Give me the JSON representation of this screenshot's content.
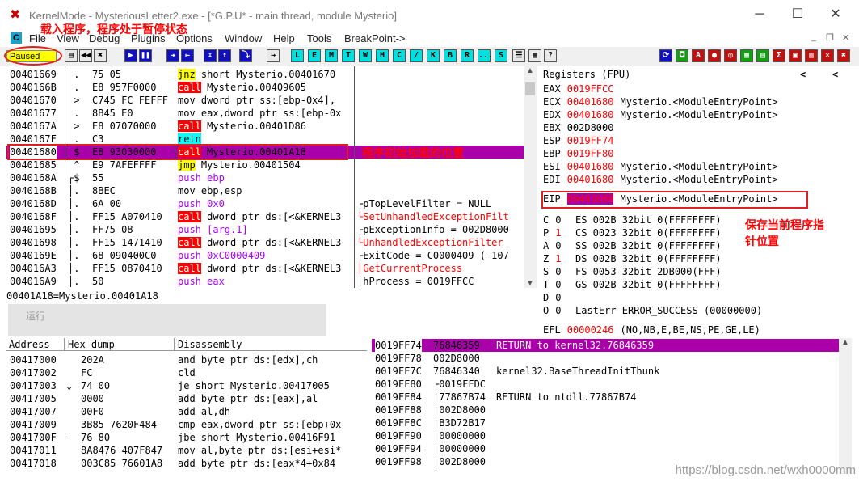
{
  "window": {
    "title": "KernelMode - MysteriousLetter2.exe - [*G.P.U* - main thread, module Mysterio]",
    "controls": {
      "minimize": "─",
      "maximize": "☐",
      "close": "✕"
    },
    "mdi_controls": {
      "minimize": "_",
      "restore": "❐",
      "close": "✕"
    }
  },
  "menu": {
    "c_label": "C",
    "items": [
      "File",
      "View",
      "Debug",
      "Plugins",
      "Options",
      "Window",
      "Help",
      "Tools",
      "BreakPoint->"
    ],
    "annotation": "载入程序，程序处于暂停状态"
  },
  "toolbar": {
    "status": "Paused",
    "buttons": [
      "◀◀",
      "✖",
      "▶",
      "❚❚",
      "⇥",
      "⇤",
      "↧",
      "↥",
      "⤵",
      "→"
    ],
    "letters": [
      "L",
      "E",
      "M",
      "T",
      "W",
      "H",
      "C",
      "/",
      "K",
      "B",
      "R",
      "...",
      "S"
    ],
    "right_icons": [
      "▦",
      "?"
    ]
  },
  "cpu": {
    "rows": [
      {
        "addr": "00401669",
        "mark": " . ",
        "hex": "75 05",
        "asm_kw": "jnz",
        "kw_type": "jmp",
        "asm": " short Mysterio.00401670",
        "comment": ""
      },
      {
        "addr": "0040166B",
        "mark": " . ",
        "hex": "E8 957F0000",
        "asm_kw": "call",
        "kw_type": "call",
        "asm": " Mysterio.00409605",
        "comment": ""
      },
      {
        "addr": "00401670",
        "mark": " > ",
        "hex": "C745 FC FEFFF",
        "asm_kw": "",
        "kw_type": "",
        "asm": "mov dword ptr ss:[ebp-0x4],",
        "comment": ""
      },
      {
        "addr": "00401677",
        "mark": " . ",
        "hex": "8B45 E0",
        "asm_kw": "",
        "kw_type": "",
        "asm": "mov eax,dword ptr ss:[ebp-0x",
        "comment": ""
      },
      {
        "addr": "0040167A",
        "mark": " > ",
        "hex": "E8 07070000",
        "asm_kw": "call",
        "kw_type": "call",
        "asm": " Mysterio.00401D86",
        "comment": ""
      },
      {
        "addr": "0040167F",
        "mark": " . ",
        "hex": "C3",
        "asm_kw": "retn",
        "kw_type": "retn",
        "asm": "",
        "comment": ""
      },
      {
        "addr": "00401680",
        "mark": " $ ",
        "hex": "E8 93030000",
        "asm_kw": "call",
        "kw_type": "call",
        "asm": " Mysterio.00401A18",
        "comment": ""
      },
      {
        "addr": "00401685",
        "mark": " ^ ",
        "hex": "E9 7AFEFFFF",
        "asm_kw": "jmp",
        "kw_type": "jmp",
        "asm": " Mysterio.00401504",
        "comment": ""
      },
      {
        "addr": "0040168A",
        "mark": "┌$ ",
        "hex": "55",
        "asm_kw": "push",
        "kw_type": "push",
        "asm": " ebp",
        "comment": ""
      },
      {
        "addr": "0040168B",
        "mark": "│. ",
        "hex": "8BEC",
        "asm_kw": "",
        "kw_type": "",
        "asm": "mov ebp,esp",
        "comment": ""
      },
      {
        "addr": "0040168D",
        "mark": "│. ",
        "hex": "6A 00",
        "asm_kw": "push",
        "kw_type": "push",
        "asm": " 0x0",
        "comment": "┌pTopLevelFilter = NULL"
      },
      {
        "addr": "0040168F",
        "mark": "│. ",
        "hex": "FF15 A070410",
        "asm_kw": "call",
        "kw_type": "call",
        "asm": " dword ptr ds:[<&KERNEL3",
        "comment": "└SetUnhandledExceptionFilt"
      },
      {
        "addr": "00401695",
        "mark": "│. ",
        "hex": "FF75 08",
        "asm_kw": "push",
        "kw_type": "push",
        "asm": " [arg.1]",
        "comment": "┌pExceptionInfo = 002D8000"
      },
      {
        "addr": "00401698",
        "mark": "│. ",
        "hex": "FF15 1471410",
        "asm_kw": "call",
        "kw_type": "call",
        "asm": " dword ptr ds:[<&KERNEL3",
        "comment": "└UnhandledExceptionFilter"
      },
      {
        "addr": "0040169E",
        "mark": "│. ",
        "hex": "68 090400C0",
        "asm_kw": "push",
        "kw_type": "push",
        "asm": " 0xC0000409",
        "comment": "┌ExitCode = C0000409 (-107"
      },
      {
        "addr": "004016A3",
        "mark": "│. ",
        "hex": "FF15 0870410",
        "asm_kw": "call",
        "kw_type": "call",
        "asm": " dword ptr ds:[<&KERNEL3",
        "comment": "│GetCurrentProcess"
      },
      {
        "addr": "004016A9",
        "mark": "│. ",
        "hex": "50",
        "asm_kw": "push",
        "kw_type": "push",
        "asm": " eax",
        "comment": "│hProcess = 0019FFCC"
      }
    ],
    "annotation": "程序初始加载的位置",
    "info": "00401A18=Mysterio.00401A18",
    "ghost": "运行"
  },
  "registers": {
    "header": "Registers (FPU)",
    "left_arrow": "<",
    "right_arrow": "<",
    "gp": [
      {
        "name": "EAX",
        "value": "0019FFCC",
        "red": true,
        "desc": ""
      },
      {
        "name": "ECX",
        "value": "00401680",
        "red": true,
        "desc": "Mysterio.<ModuleEntryPoint>"
      },
      {
        "name": "EDX",
        "value": "00401680",
        "red": true,
        "desc": "Mysterio.<ModuleEntryPoint>"
      },
      {
        "name": "EBX",
        "value": "002D8000",
        "red": false,
        "desc": ""
      },
      {
        "name": "ESP",
        "value": "0019FF74",
        "red": true,
        "desc": ""
      },
      {
        "name": "EBP",
        "value": "0019FF80",
        "red": true,
        "desc": ""
      },
      {
        "name": "ESI",
        "value": "00401680",
        "red": true,
        "desc": "Mysterio.<ModuleEntryPoint>"
      },
      {
        "name": "EDI",
        "value": "00401680",
        "red": true,
        "desc": "Mysterio.<ModuleEntryPoint>"
      }
    ],
    "eip": {
      "name": "EIP",
      "value": "00401680",
      "desc": "Mysterio.<ModuleEntryPoint>"
    },
    "flags": [
      {
        "flag": "C",
        "val": "0",
        "red": false,
        "seg": "ES 002B 32bit 0(FFFFFFFF)"
      },
      {
        "flag": "P",
        "val": "1",
        "red": true,
        "seg": "CS 0023 32bit 0(FFFFFFFF)"
      },
      {
        "flag": "A",
        "val": "0",
        "red": false,
        "seg": "SS 002B 32bit 0(FFFFFFFF)"
      },
      {
        "flag": "Z",
        "val": "1",
        "red": true,
        "seg": "DS 002B 32bit 0(FFFFFFFF)"
      },
      {
        "flag": "S",
        "val": "0",
        "red": false,
        "seg": "FS 0053 32bit 2DB000(FFF)"
      },
      {
        "flag": "T",
        "val": "0",
        "red": false,
        "seg": "GS 002B 32bit 0(FFFFFFFF)"
      },
      {
        "flag": "D",
        "val": "0",
        "red": false,
        "seg": ""
      },
      {
        "flag": "O",
        "val": "0",
        "red": false,
        "seg": "LastErr ERROR_SUCCESS (00000000)"
      }
    ],
    "efl": {
      "name": "EFL",
      "value": "00000246",
      "desc": "(NO,NB,E,BE,NS,PE,GE,LE)"
    },
    "annotation_line1": "保存当前程序指",
    "annotation_line2": "针位置"
  },
  "dump": {
    "headers": {
      "address": "Address",
      "hex": "Hex dump",
      "disasm": "Disassembly"
    },
    "rows": [
      {
        "addr": "00417000",
        "mark": " ",
        "hex": "202A",
        "asm": "and byte ptr ds:[edx],ch"
      },
      {
        "addr": "00417002",
        "mark": " ",
        "hex": "FC",
        "asm": "cld"
      },
      {
        "addr": "00417003",
        "mark": "⌄",
        "hex": "74 00",
        "asm": "je short Mysterio.00417005"
      },
      {
        "addr": "00417005",
        "mark": " ",
        "hex": "0000",
        "asm": "add byte ptr ds:[eax],al"
      },
      {
        "addr": "00417007",
        "mark": " ",
        "hex": "00F0",
        "asm": "add al,dh"
      },
      {
        "addr": "00417009",
        "mark": " ",
        "hex": "3B85 7620F484",
        "asm": "cmp eax,dword ptr ss:[ebp+0x"
      },
      {
        "addr": "0041700F",
        "mark": "-",
        "hex": "76 80",
        "asm": "jbe short Mysterio.00416F91"
      },
      {
        "addr": "00417011",
        "mark": " ",
        "hex": "8A8476 407F847",
        "asm": "mov al,byte ptr ds:[esi+esi*"
      },
      {
        "addr": "00417018",
        "mark": " ",
        "hex": "003C85 76601A8",
        "asm": "add byte ptr ds:[eax*4+0x84"
      }
    ]
  },
  "stack": {
    "rows": [
      {
        "addr": "0019FF74",
        "value": "76846359",
        "comment": "RETURN to kernel32.76846359",
        "hl": true
      },
      {
        "addr": "0019FF78",
        "value": "002D8000",
        "comment": "",
        "hl": false
      },
      {
        "addr": "0019FF7C",
        "value": "76846340",
        "comment": "kernel32.BaseThreadInitThunk",
        "hl": false
      },
      {
        "addr": "0019FF80",
        "value": "┌0019FFDC",
        "comment": "",
        "hl": false
      },
      {
        "addr": "0019FF84",
        "value": "│77867B74",
        "comment": "RETURN to ntdll.77867B74",
        "hl": false
      },
      {
        "addr": "0019FF88",
        "value": "│002D8000",
        "comment": "",
        "hl": false
      },
      {
        "addr": "0019FF8C",
        "value": "│B3D72B17",
        "comment": "",
        "hl": false
      },
      {
        "addr": "0019FF90",
        "value": "│00000000",
        "comment": "",
        "hl": false
      },
      {
        "addr": "0019FF94",
        "value": "│00000000",
        "comment": "",
        "hl": false
      },
      {
        "addr": "0019FF98",
        "value": "│002D8000",
        "comment": "",
        "hl": false
      }
    ]
  },
  "watermark": "https://blog.csdn.net/wxh0000mm"
}
